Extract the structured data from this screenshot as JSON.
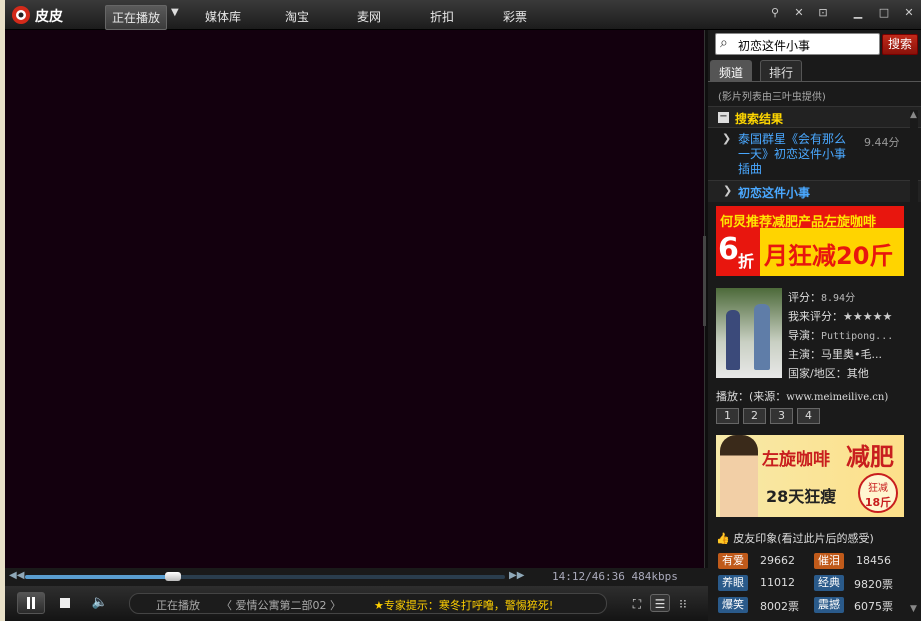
{
  "app": {
    "name": "皮皮"
  },
  "nav": {
    "items": [
      "正在播放",
      "媒体库",
      "淘宝",
      "麦网",
      "折扣",
      "彩票"
    ]
  },
  "window_buttons": [
    "pin",
    "skin",
    "mini",
    "minimize",
    "maximize",
    "close"
  ],
  "player": {
    "seek_fraction": 0.308,
    "time": "14:12/46:36",
    "bitrate": "484kbps",
    "now_label": "正在播放",
    "now_title": "〈 爱情公寓第二部02 〉",
    "tip": "★专家提示：寒冬打呼噜，警惕猝死!"
  },
  "search": {
    "value": "初恋这件小事",
    "button": "搜索"
  },
  "tabs": [
    "频道",
    "排行"
  ],
  "provider": "(影片列表由三叶虫提供)",
  "results": {
    "title": "搜索结果",
    "item": "泰国群星《会有那么一天》初恋这件小事插曲",
    "score": "9.44分"
  },
  "movie": {
    "title": "初恋这件小事",
    "ad1_top": "何炅推荐减肥产品左旋咖啡",
    "ad1_discount": "6",
    "ad1_zhe": "折",
    "ad1_main": "月狂减20斤",
    "rating_label": "评分：",
    "rating": "8.94分",
    "my_rating_label": "我来评分：",
    "my_rating": "★★★★★",
    "director_label": "导演：",
    "director": "Puttipong...",
    "cast_label": "主演：",
    "cast": "马里奥•毛...",
    "region_label": "国家/地区：",
    "region": "其他",
    "source_label": "播放：(来源：",
    "source": "www.meimeilive.cn)",
    "episodes": [
      "1",
      "2",
      "3",
      "4"
    ]
  },
  "ad2": {
    "t1": "左旋咖啡",
    "t2": "减肥",
    "t3": "28天狂瘦",
    "badge1": "狂减",
    "badge2": "18斤"
  },
  "impressions": {
    "title": "皮友印象(看过此片后的感受)",
    "items": [
      {
        "label": "有爱",
        "count": "29662",
        "color": "orange"
      },
      {
        "label": "催泪",
        "count": "18456",
        "color": "orange"
      },
      {
        "label": "养眼",
        "count": "11012",
        "color": "blue"
      },
      {
        "label": "经典",
        "count": "9820票",
        "color": "blue"
      },
      {
        "label": "爆笑",
        "count": "8002票",
        "color": "blue"
      },
      {
        "label": "震撼",
        "count": "6075票",
        "color": "blue"
      }
    ]
  }
}
